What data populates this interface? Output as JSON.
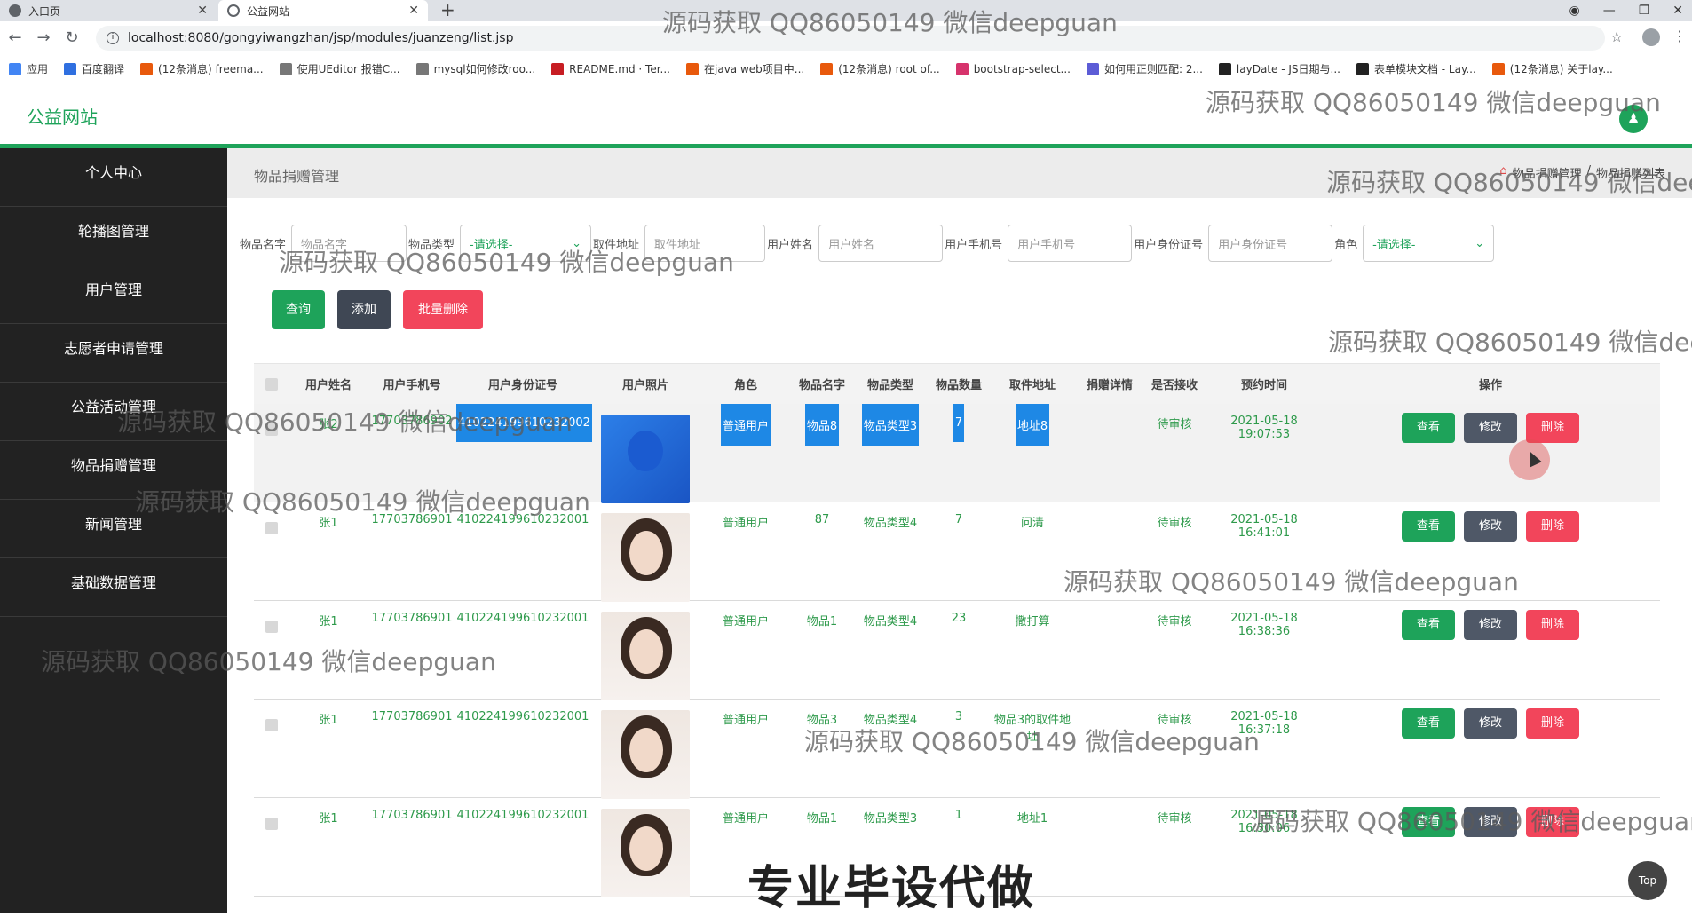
{
  "browser": {
    "tabs": [
      {
        "title": "入口页",
        "active": false
      },
      {
        "title": "公益网站",
        "active": true
      }
    ],
    "url": "localhost:8080/gongyiwangzhan/jsp/modules/juanzeng/list.jsp",
    "bookmarks": [
      "应用",
      "百度翻译",
      "(12条消息) freema...",
      "使用UEditor 报错C...",
      "mysql如何修改roo...",
      "README.md · Ter...",
      "在java web项目中...",
      "(12条消息) root of...",
      "bootstrap-select...",
      "如何用正则匹配: 2...",
      "layDate - JS日期与...",
      "表单模块文档 - Lay...",
      "(12条消息) 关于lay..."
    ]
  },
  "site": {
    "logo": "公益网站"
  },
  "sidebar": {
    "items": [
      {
        "label": "个人中心"
      },
      {
        "label": "轮播图管理"
      },
      {
        "label": "用户管理"
      },
      {
        "label": "志愿者申请管理"
      },
      {
        "label": "公益活动管理"
      },
      {
        "label": "物品捐赠管理"
      },
      {
        "label": "新闻管理"
      },
      {
        "label": "基础数据管理"
      }
    ]
  },
  "page": {
    "title": "物品捐赠管理",
    "breadcrumb": [
      "物品捐赠管理",
      "/",
      "物品捐赠列表"
    ]
  },
  "search": {
    "fields": [
      {
        "label": "物品名字",
        "placeholder": "物品名字"
      },
      {
        "label": "物品类型",
        "select": "-请选择-"
      },
      {
        "label": "取件地址",
        "placeholder": "取件地址"
      },
      {
        "label": "用户姓名",
        "placeholder": "用户姓名"
      },
      {
        "label": "用户手机号",
        "placeholder": "用户手机号"
      },
      {
        "label": "用户身份证号",
        "placeholder": "用户身份证号"
      },
      {
        "label": "角色",
        "select": "-请选择-"
      }
    ],
    "query_label": "查询",
    "add_label": "添加",
    "bulk_delete_label": "批量删除"
  },
  "table": {
    "headers": [
      "用户姓名",
      "用户手机号",
      "用户身份证号",
      "用户照片",
      "角色",
      "物品名字",
      "物品类型",
      "物品数量",
      "取件地址",
      "捐赠详情",
      "是否接收",
      "预约时间",
      "操作"
    ],
    "rows": [
      {
        "name": "张2",
        "phone": "17703786902",
        "idcard": "410224199610232002",
        "photo": "blue",
        "role": "普通用户",
        "item": "物品8",
        "type": "物品类型3",
        "qty": "7",
        "addr": "地址8",
        "detail": "",
        "status": "待审核",
        "time": "2021-05-18 19:07:53",
        "highlight": true
      },
      {
        "name": "张1",
        "phone": "17703786901",
        "idcard": "410224199610232001",
        "photo": "face",
        "role": "普通用户",
        "item": "87",
        "type": "物品类型4",
        "qty": "7",
        "addr": "问清",
        "detail": "",
        "status": "待审核",
        "time": "2021-05-18 16:41:01",
        "highlight": false
      },
      {
        "name": "张1",
        "phone": "17703786901",
        "idcard": "410224199610232001",
        "photo": "face",
        "role": "普通用户",
        "item": "物品1",
        "type": "物品类型4",
        "qty": "23",
        "addr": "撒打算",
        "detail": "",
        "status": "待审核",
        "time": "2021-05-18 16:38:36",
        "highlight": false
      },
      {
        "name": "张1",
        "phone": "17703786901",
        "idcard": "410224199610232001",
        "photo": "face",
        "role": "普通用户",
        "item": "物品3",
        "type": "物品类型4",
        "qty": "3",
        "addr": "物品3的取件地址",
        "detail": "",
        "status": "待审核",
        "time": "2021-05-18 16:37:18",
        "highlight": false
      },
      {
        "name": "张1",
        "phone": "17703786901",
        "idcard": "410224199610232001",
        "photo": "face",
        "role": "普通用户",
        "item": "物品1",
        "type": "物品类型3",
        "qty": "1",
        "addr": "地址1",
        "detail": "",
        "status": "待审核",
        "time": "2021-05-18 16:30:06",
        "highlight": false
      }
    ],
    "actions": {
      "view": "查看",
      "edit": "修改",
      "delete": "删除"
    }
  },
  "top_button": "Top",
  "watermark": "源码获取 QQ86050149 微信deepguan",
  "banner": "专业毕设代做",
  "colors": {
    "brand": "#1ea35a",
    "sidebar": "#222222",
    "danger": "#f2455b",
    "dark_button": "#3f4754"
  }
}
